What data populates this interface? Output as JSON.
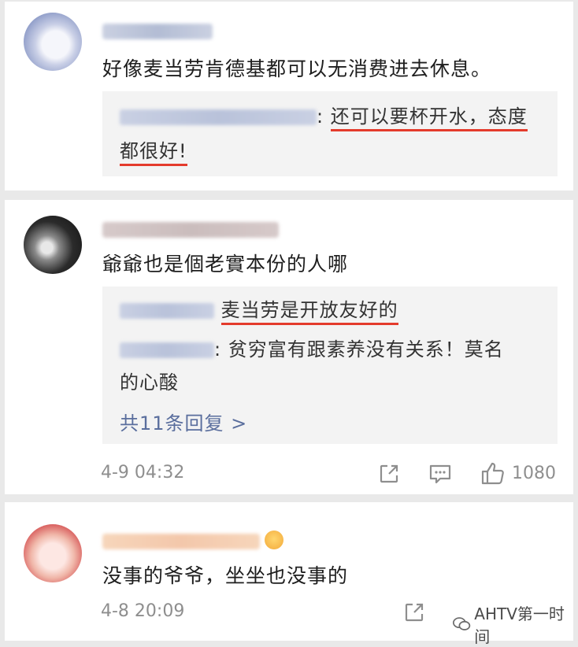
{
  "comments": [
    {
      "text": "好像麦当劳肯德基都可以无消费进去休息。",
      "replies": [
        {
          "line1": "还可以要杯开水，态度",
          "line2": "都很好!"
        }
      ]
    },
    {
      "text": "爺爺也是個老實本份的人哪",
      "replies": [
        {
          "text": "麦当劳是开放友好的"
        },
        {
          "text1": "贫穷富有跟素养没有关系！莫名",
          "text2": "的心酸"
        }
      ],
      "more_replies": "共11条回复 >",
      "time": "4-9 04:32",
      "like_count": "1080"
    },
    {
      "text": "没事的爷爷，坐坐也没事的",
      "time": "4-8 20:09"
    }
  ],
  "watermark": "AHTV第一时间",
  "icons": {
    "share": "share-icon",
    "comment": "comment-icon",
    "like": "thumbs-up-icon"
  },
  "colors": {
    "underline": "#e43b2c",
    "link": "#5a6e9d",
    "meta": "#8e8e8e"
  }
}
